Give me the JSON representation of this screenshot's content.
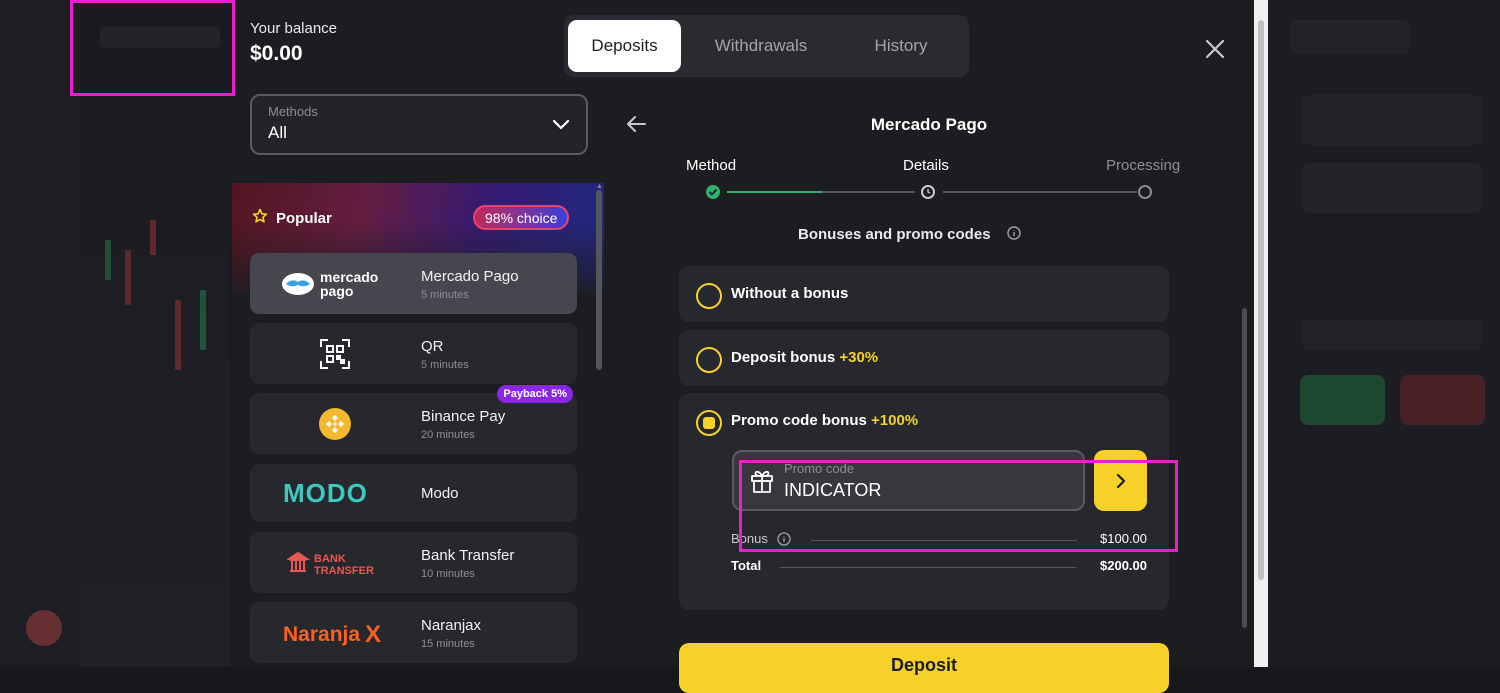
{
  "header": {
    "balance_label": "Your balance",
    "balance_value": "$0.00"
  },
  "tabs": [
    {
      "label": "Deposits",
      "active": true
    },
    {
      "label": "Withdrawals",
      "active": false
    },
    {
      "label": "History",
      "active": false
    }
  ],
  "methods_filter": {
    "label": "Methods",
    "value": "All"
  },
  "popular": {
    "title": "Popular",
    "badge": "98% choice"
  },
  "payment_methods": [
    {
      "logo_text": "mercado pago",
      "name": "Mercado Pago",
      "time": "5 minutes",
      "active": true
    },
    {
      "logo_text": "QR",
      "name": "QR",
      "time": "5 minutes"
    },
    {
      "logo_text": "Binance",
      "name": "Binance Pay",
      "time": "20 minutes",
      "badge": "Payback 5%"
    },
    {
      "logo_text": "MODO",
      "name": "Modo",
      "time": ""
    },
    {
      "logo_text": "BANK TRANSFER",
      "name": "Bank Transfer",
      "time": "10 minutes"
    },
    {
      "logo_text": "NaranjaX",
      "name": "Naranjax",
      "time": "15 minutes"
    }
  ],
  "detail": {
    "title": "Mercado Pago",
    "steps": [
      "Method",
      "Details",
      "Processing"
    ],
    "current_step": 1,
    "bonus_title": "Bonuses and promo codes",
    "options": [
      {
        "label": "Without a bonus",
        "pct": "",
        "checked": false
      },
      {
        "label": "Deposit bonus",
        "pct": "+30%",
        "checked": false
      },
      {
        "label": "Promo code bonus",
        "pct": "+100%",
        "checked": true
      }
    ],
    "promo": {
      "label": "Promo code",
      "value": "INDICATOR"
    },
    "summary": {
      "bonus_label": "Bonus",
      "bonus_value": "$100.00",
      "total_label": "Total",
      "total_value": "$200.00"
    },
    "deposit_button": "Deposit"
  },
  "colors": {
    "accent": "#f5d12a",
    "success": "#2fb36b",
    "highlight": "#ec1fd0"
  }
}
